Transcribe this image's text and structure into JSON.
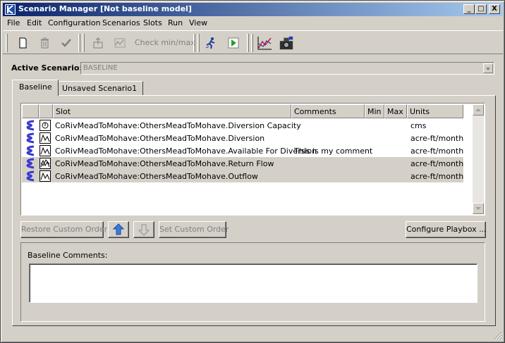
{
  "window": {
    "title": "Scenario Manager [Not baseline model]",
    "minimize": "_",
    "maximize": "□",
    "close": "X"
  },
  "menu": [
    "File",
    "Edit",
    "Configuration",
    "Scenarios",
    "Slots",
    "Run",
    "View"
  ],
  "toolbar": {
    "check_label": "Check min/max"
  },
  "active_scenario": {
    "label": "Active Scenario:",
    "value": "BASELINE"
  },
  "tabs": [
    {
      "label": "Baseline",
      "active": true
    },
    {
      "label": "Unsaved Scenario1",
      "active": false
    }
  ],
  "table": {
    "headers": [
      "Slot",
      "Comments",
      "Min",
      "Max",
      "Units"
    ],
    "rows": [
      {
        "slot": "CoRivMeadToMohave:OthersMeadToMohave.Diversion Capacity",
        "comment": "",
        "min": "",
        "max": "",
        "units": "cms",
        "selected": false,
        "slot_icon": "periodic-icon"
      },
      {
        "slot": "CoRivMeadToMohave:OthersMeadToMohave.Diversion",
        "comment": "",
        "min": "",
        "max": "",
        "units": "acre-ft/month",
        "selected": false,
        "slot_icon": "series-icon"
      },
      {
        "slot": "CoRivMeadToMohave:OthersMeadToMohave.Available For Diversion",
        "comment": "This is my comment",
        "min": "",
        "max": "",
        "units": "acre-ft/month",
        "selected": false,
        "slot_icon": "series-icon"
      },
      {
        "slot": "CoRivMeadToMohave:OthersMeadToMohave.Return Flow",
        "comment": "",
        "min": "",
        "max": "",
        "units": "acre-ft/month",
        "selected": true,
        "slot_icon": "multi-series-icon"
      },
      {
        "slot": "CoRivMeadToMohave:OthersMeadToMohave.Outflow",
        "comment": "",
        "min": "",
        "max": "",
        "units": "acre-ft/month",
        "selected": true,
        "slot_icon": "series-icon"
      }
    ]
  },
  "buttons": {
    "restore": "Restore Custom Order",
    "set": "Set Custom Order",
    "configure": "Configure Playbox ..."
  },
  "comments": {
    "label": "Baseline Comments:",
    "value": ""
  },
  "colors": {
    "title_start": "#0a246a",
    "title_end": "#a6caf0",
    "face": "#d4d0c8",
    "flow_icon": "#3a3ad0"
  }
}
